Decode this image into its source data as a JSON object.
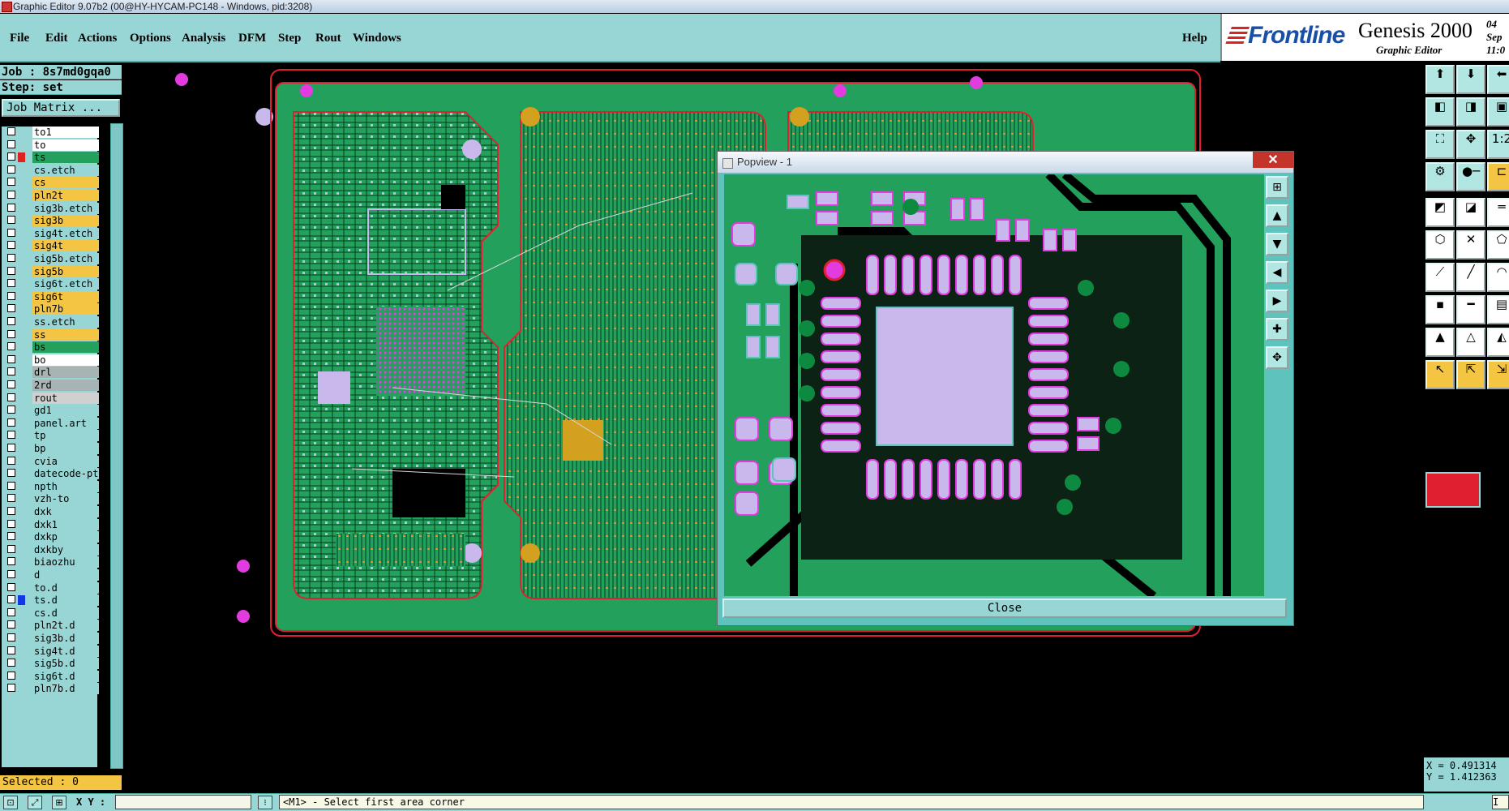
{
  "window": {
    "title": "Graphic Editor 9.07b2 (00@HY-HYCAM-PC148 - Windows, pid:3208)"
  },
  "menu": {
    "items": [
      "File",
      "Edit",
      "Actions",
      "Options",
      "Analysis",
      "DFM",
      "Step",
      "Rout",
      "Windows"
    ],
    "help": "Help"
  },
  "branding": {
    "company": "Frontline",
    "product": "Genesis 2000",
    "subtitle": "Graphic Editor",
    "date_fragment": "04 Sep",
    "time_fragment": "11:0"
  },
  "job": {
    "job_line": "Job : 8s7md0gqa0",
    "step_line": "Step: set",
    "matrix_button": "Job Matrix ..."
  },
  "layers": [
    {
      "name": "to1",
      "color": "#ffffff",
      "sw": ""
    },
    {
      "name": "to",
      "color": "#ffffff",
      "sw": ""
    },
    {
      "name": "ts",
      "color": "#22a05c",
      "sw": "#d22"
    },
    {
      "name": "cs.etch",
      "color": "#98d6d6",
      "sw": ""
    },
    {
      "name": "cs",
      "color": "#f4c542",
      "sw": ""
    },
    {
      "name": "pln2t",
      "color": "#f4c542",
      "sw": ""
    },
    {
      "name": "sig3b.etch",
      "color": "#98d6d6",
      "sw": ""
    },
    {
      "name": "sig3b",
      "color": "#f4c542",
      "sw": ""
    },
    {
      "name": "sig4t.etch",
      "color": "#98d6d6",
      "sw": ""
    },
    {
      "name": "sig4t",
      "color": "#f4c542",
      "sw": ""
    },
    {
      "name": "sig5b.etch",
      "color": "#98d6d6",
      "sw": ""
    },
    {
      "name": "sig5b",
      "color": "#f4c542",
      "sw": ""
    },
    {
      "name": "sig6t.etch",
      "color": "#98d6d6",
      "sw": ""
    },
    {
      "name": "sig6t",
      "color": "#f4c542",
      "sw": ""
    },
    {
      "name": "pln7b",
      "color": "#f4c542",
      "sw": ""
    },
    {
      "name": "ss.etch",
      "color": "#98d6d6",
      "sw": ""
    },
    {
      "name": "ss",
      "color": "#f4c542",
      "sw": ""
    },
    {
      "name": "bs",
      "color": "#22a05c",
      "sw": ""
    },
    {
      "name": "bo",
      "color": "#ffffff",
      "sw": ""
    },
    {
      "name": "drl",
      "color": "#a8b4b4",
      "sw": ""
    },
    {
      "name": "2rd",
      "color": "#a8b4b4",
      "sw": ""
    },
    {
      "name": "rout",
      "color": "#d0d0d0",
      "sw": ""
    },
    {
      "name": "gd1",
      "color": "#98d6d6",
      "sw": ""
    },
    {
      "name": "panel.art",
      "color": "#98d6d6",
      "sw": ""
    },
    {
      "name": "tp",
      "color": "#98d6d6",
      "sw": ""
    },
    {
      "name": "bp",
      "color": "#98d6d6",
      "sw": ""
    },
    {
      "name": "cvia",
      "color": "#98d6d6",
      "sw": ""
    },
    {
      "name": "datecode-pt",
      "color": "#98d6d6",
      "sw": ""
    },
    {
      "name": "npth",
      "color": "#98d6d6",
      "sw": ""
    },
    {
      "name": "vzh-to",
      "color": "#98d6d6",
      "sw": ""
    },
    {
      "name": "dxk",
      "color": "#98d6d6",
      "sw": ""
    },
    {
      "name": "dxk1",
      "color": "#98d6d6",
      "sw": ""
    },
    {
      "name": "dxkp",
      "color": "#98d6d6",
      "sw": ""
    },
    {
      "name": "dxkby",
      "color": "#98d6d6",
      "sw": ""
    },
    {
      "name": "biaozhu",
      "color": "#98d6d6",
      "sw": ""
    },
    {
      "name": "d",
      "color": "#98d6d6",
      "sw": ""
    },
    {
      "name": "to.d",
      "color": "#98d6d6",
      "sw": ""
    },
    {
      "name": "ts.d",
      "color": "#98d6d6",
      "sw": "#1238e6"
    },
    {
      "name": "cs.d",
      "color": "#98d6d6",
      "sw": ""
    },
    {
      "name": "pln2t.d",
      "color": "#98d6d6",
      "sw": ""
    },
    {
      "name": "sig3b.d",
      "color": "#98d6d6",
      "sw": ""
    },
    {
      "name": "sig4t.d",
      "color": "#98d6d6",
      "sw": ""
    },
    {
      "name": "sig5b.d",
      "color": "#98d6d6",
      "sw": ""
    },
    {
      "name": "sig6t.d",
      "color": "#98d6d6",
      "sw": ""
    },
    {
      "name": "pln7b.d",
      "color": "#98d6d6",
      "sw": ""
    }
  ],
  "selected_text": "Selected : 0",
  "popview": {
    "title": "Popview - 1",
    "close_x": "✕",
    "close_button": "Close"
  },
  "coords": {
    "x": "X = 0.491314",
    "y": "Y = 1.412363"
  },
  "status": {
    "xy_label": "X Y :",
    "xy_value": "",
    "message": "<M1> - Select first area corner",
    "right_trim": "I"
  },
  "colors": {
    "board": "#22a05c",
    "pad": "#c8b8ec",
    "pad_outline": "#e23ce0",
    "panel_border": "#e02030",
    "ui_bg": "#98d6d6",
    "highlight": "#f4c542"
  }
}
